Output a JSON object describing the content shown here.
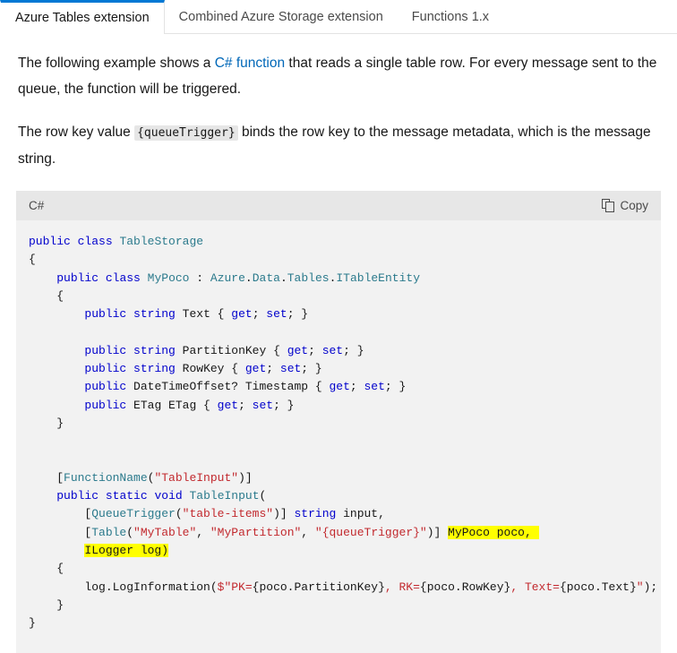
{
  "tabs": [
    {
      "label": "Azure Tables extension",
      "active": true
    },
    {
      "label": "Combined Azure Storage extension",
      "active": false
    },
    {
      "label": "Functions 1.x",
      "active": false
    }
  ],
  "paragraphs": {
    "p1_before_link": "The following example shows a ",
    "p1_link": "C# function",
    "p1_after_link": " that reads a single table row. For every message sent to the queue, the function will be triggered.",
    "p2_before_code": "The row key value ",
    "p2_code": "{queueTrigger}",
    "p2_after_code": " binds the row key to the message metadata, which is the message string."
  },
  "code_block": {
    "language": "C#",
    "copy_label": "Copy",
    "copy_icon": "copy-icon",
    "lines": [
      "public class TableStorage",
      "{",
      "    public class MyPoco : Azure.Data.Tables.ITableEntity",
      "    {",
      "        public string Text { get; set; }",
      "",
      "        public string PartitionKey { get; set; }",
      "        public string RowKey { get; set; }",
      "        public DateTimeOffset? Timestamp { get; set; }",
      "        public ETag ETag { get; set; }",
      "    }",
      "",
      "",
      "    [FunctionName(\"TableInput\")]",
      "    public static void TableInput(",
      "        [QueueTrigger(\"table-items\")] string input,",
      "        [Table(\"MyTable\", \"MyPartition\", \"{queueTrigger}\")] MyPoco poco,",
      "        ILogger log)",
      "    {",
      "        log.LogInformation($\"PK={poco.PartitionKey}, RK={poco.RowKey}, Text={poco.Text}\");",
      "    }",
      "}"
    ],
    "highlighted_fragments": [
      "MyPoco poco,",
      "ILogger log)"
    ]
  },
  "colors": {
    "accent": "#0078d4",
    "link": "#0067b8",
    "keyword": "#0000cc",
    "type": "#2b7a8c",
    "string": "#c2292e",
    "highlight": "#ffff00",
    "code_bg": "#f2f2f2",
    "code_header_bg": "#e7e7e7"
  }
}
